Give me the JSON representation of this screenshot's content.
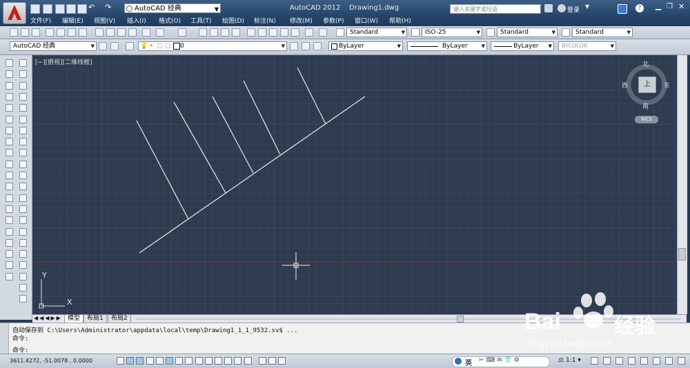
{
  "title_bar": {
    "workspace": "AutoCAD 经典",
    "app_title": "AutoCAD 2012    Drawing1.dwg",
    "search_placeholder": "键入关键字或短语",
    "login": "登录"
  },
  "menu": [
    "文件(F)",
    "编辑(E)",
    "视图(V)",
    "插入(I)",
    "格式(O)",
    "工具(T)",
    "绘图(D)",
    "标注(N)",
    "修改(M)",
    "参数(P)",
    "窗口(W)",
    "帮助(H)"
  ],
  "styles_toolbar": {
    "text_style": "Standard",
    "dim_style": "ISO-25",
    "table_style": "Standard",
    "mleader_style": "Standard"
  },
  "layers_toolbar": {
    "workspace": "AutoCAD 经典",
    "layer": "0",
    "color": "ByLayer",
    "linetype": "ByLayer",
    "lineweight": "ByLayer",
    "plotstyle": "BYCOLOR"
  },
  "viewport": {
    "label": "[−][俯视][二维线框]",
    "viewcube": {
      "north": "北",
      "south": "南",
      "east": "东",
      "west": "西",
      "top": "上",
      "wcs": "WCS"
    },
    "ucs": {
      "x": "X",
      "y": "Y"
    }
  },
  "tabs": [
    "模型",
    "布局1",
    "布局2"
  ],
  "command_line": {
    "history": "自动保存到 C:\\Users\\Administrator\\appdata\\local\\temp\\Drawing1_1_1_9532.sv$ ...",
    "prompt1": "命令:",
    "prompt2": "命令:"
  },
  "status_bar": {
    "coordinates": "3611.4272, -51.0078 , 0.0000",
    "ime": "英",
    "scale": "1:1"
  },
  "colors": {
    "canvas": "#2e3b4e",
    "title_bar": "#27456a",
    "crosshair_axis": "#8a2b2b"
  },
  "watermark": {
    "brand": "Bai",
    "brand2": "经验",
    "url": "jingyan.baidu.com"
  }
}
